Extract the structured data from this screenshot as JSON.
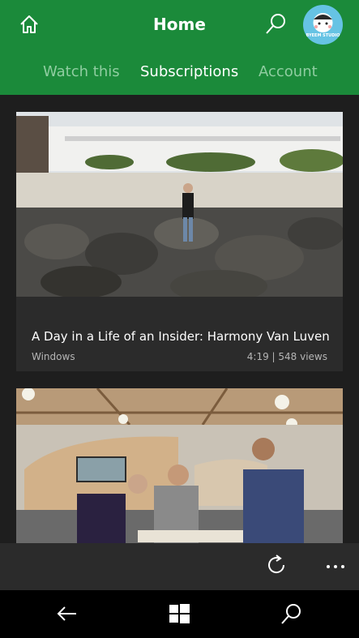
{
  "header": {
    "title": "Home",
    "avatar_text": "BYEEM STUDIO",
    "tabs": [
      {
        "label": "Watch this",
        "active": false
      },
      {
        "label": "Subscriptions",
        "active": true
      },
      {
        "label": "Account",
        "active": false
      }
    ]
  },
  "feed": {
    "videos": [
      {
        "title": "A Day in a Life of an Insider: Harmony Van Luven",
        "channel": "Windows",
        "meta": "4:19 | 548 views"
      }
    ]
  },
  "colors": {
    "brand_green": "#1b8a3a",
    "background": "#1e1e1e",
    "card": "#2b2b2b"
  },
  "icons": [
    "home-icon",
    "search-icon",
    "refresh-icon",
    "more-icon",
    "back-icon",
    "windows-start-icon"
  ]
}
